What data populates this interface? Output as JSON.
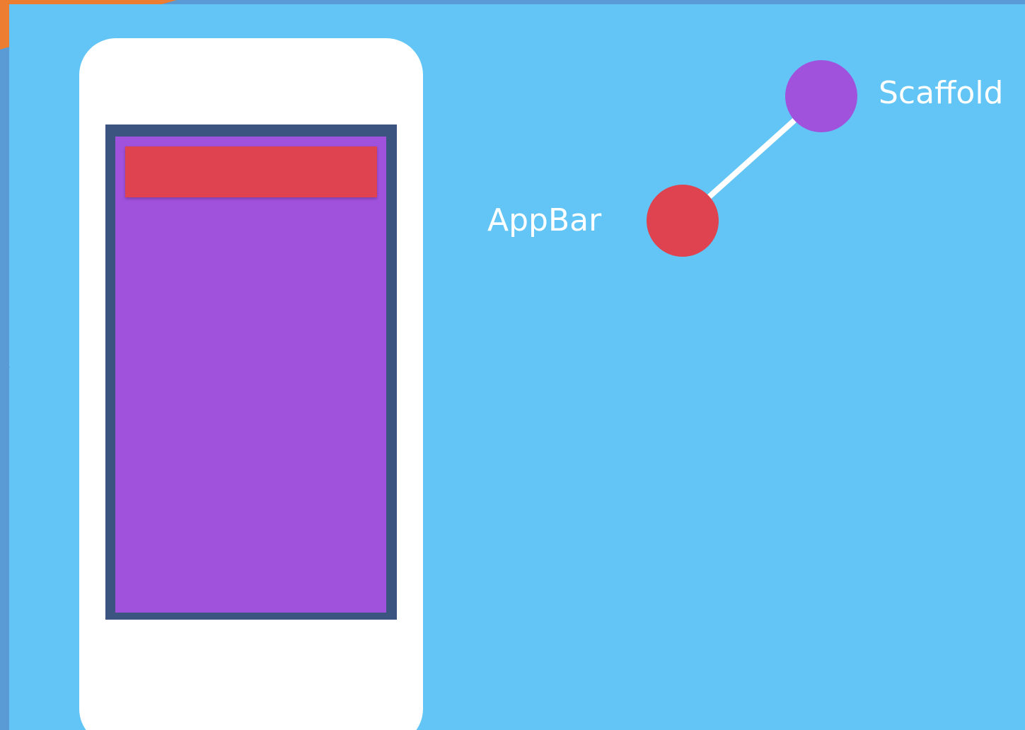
{
  "diagram": {
    "nodes": [
      {
        "id": "scaffold",
        "label": "Scaffold",
        "color": "#a152dd"
      },
      {
        "id": "appbar",
        "label": "AppBar",
        "color": "#df4350"
      }
    ],
    "edges": [
      {
        "from": "scaffold",
        "to": "appbar"
      }
    ]
  },
  "colors": {
    "background": "#62c5f5",
    "slide_border": "#5b9bd5",
    "accent": "#ed7d31",
    "phone_body": "#ffffff",
    "screen_border": "#3b5480",
    "scaffold": "#a152dd",
    "appbar": "#df4350",
    "edge": "#ffffff"
  }
}
